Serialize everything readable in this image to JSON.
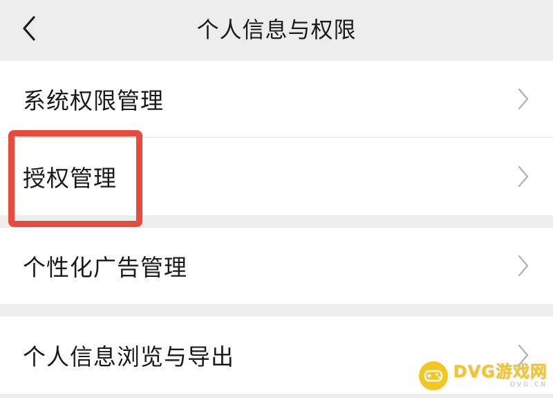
{
  "header": {
    "title": "个人信息与权限",
    "back_icon": "chevron-left-icon"
  },
  "menu": {
    "items": [
      {
        "label": "系统权限管理",
        "icon": "chevron-right-icon"
      },
      {
        "label": "授权管理",
        "icon": "chevron-right-icon"
      },
      {
        "label": "个性化广告管理",
        "icon": "chevron-right-icon"
      },
      {
        "label": "个人信息浏览与导出",
        "icon": "chevron-right-icon"
      }
    ]
  },
  "highlight": {
    "color": "#e84b3c"
  },
  "watermark": {
    "text": "DVG游戏网",
    "sub": "DVG.CN",
    "color": "#f3c623"
  },
  "colors": {
    "background": "#ededed",
    "row": "#ffffff",
    "chevron": "#b3b3b3"
  }
}
